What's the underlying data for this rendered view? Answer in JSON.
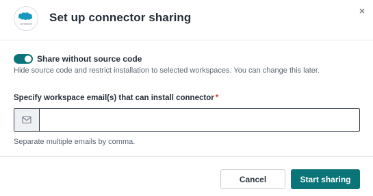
{
  "modal": {
    "title": "Set up connector sharing",
    "logo": {
      "icon": "salesforce-cloud-icon",
      "brand_text": "salesforce",
      "sub_text": "connector"
    }
  },
  "toggle": {
    "label": "Share without source code",
    "checked": true,
    "description": "Hide source code and restrict installation to selected workspaces. You can change this later."
  },
  "email_field": {
    "label": "Specify workspace email(s) that can install connector",
    "required_mark": "*",
    "value": "",
    "placeholder": "",
    "prefix_icon": "mail-icon",
    "hint": "Separate multiple emails by comma."
  },
  "footer": {
    "cancel_label": "Cancel",
    "submit_label": "Start sharing"
  },
  "colors": {
    "accent": "#0b7478",
    "required": "#d0342c",
    "salesforce_blue": "#1798c1"
  }
}
